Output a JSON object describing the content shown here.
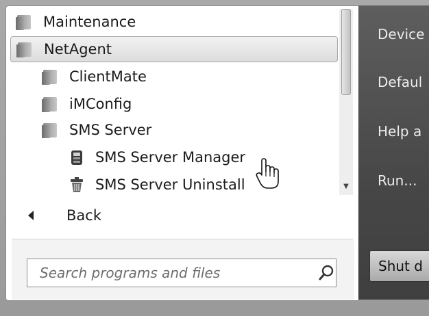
{
  "programs": [
    {
      "label": "Maintenance",
      "icon": "folder-icon",
      "indent": 0,
      "selected": false
    },
    {
      "label": "NetAgent",
      "icon": "folder-icon",
      "indent": 0,
      "selected": true
    },
    {
      "label": "ClientMate",
      "icon": "folder-icon",
      "indent": 1,
      "selected": false
    },
    {
      "label": "iMConfig",
      "icon": "folder-icon",
      "indent": 1,
      "selected": false
    },
    {
      "label": "SMS Server",
      "icon": "folder-icon",
      "indent": 1,
      "selected": false
    },
    {
      "label": "SMS Server Manager",
      "icon": "server-manager-icon",
      "indent": 2,
      "selected": false
    },
    {
      "label": "SMS Server Uninstall",
      "icon": "uninstall-icon",
      "indent": 2,
      "selected": false
    }
  ],
  "back_label": "Back",
  "search": {
    "placeholder": "Search programs and files"
  },
  "right_pane": {
    "items": [
      "Device",
      "Defaul",
      "Help a",
      "Run..."
    ],
    "shutdown_label": "Shut d"
  }
}
